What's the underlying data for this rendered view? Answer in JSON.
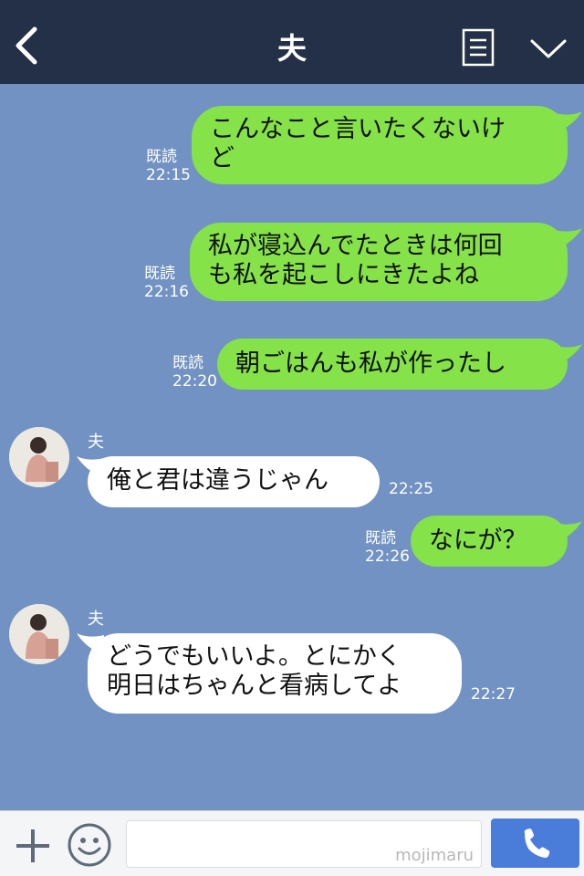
{
  "header": {
    "title": "夫",
    "back_icon": "chevron-left-icon",
    "menu_icon": "list-icon",
    "expand_icon": "chevron-down-icon"
  },
  "messages": [
    {
      "from": "me",
      "lines": [
        "こんなこと言いたくないけ",
        "ど"
      ],
      "read": "既読",
      "time": "22:15"
    },
    {
      "from": "me",
      "lines": [
        "私が寝込んでたときは何回",
        "も私を起こしにきたよね"
      ],
      "read": "既読",
      "time": "22:16"
    },
    {
      "from": "me",
      "lines": [
        "朝ごはんも私が作ったし"
      ],
      "read": "既読",
      "time": "22:20"
    },
    {
      "from": "them",
      "sender": "夫",
      "lines": [
        "俺と君は違うじゃん"
      ],
      "time": "22:25"
    },
    {
      "from": "me",
      "lines": [
        "なにが？"
      ],
      "read": "既読",
      "time": "22:26"
    },
    {
      "from": "them",
      "sender": "夫",
      "lines": [
        "どうでもいいよ。とにかく",
        "明日はちゃんと看病してよ"
      ],
      "time": "22:27"
    }
  ],
  "input": {
    "placeholder": "",
    "watermark": "mojimaru",
    "plus_icon": "plus-icon",
    "emoji_icon": "emoji-icon",
    "call_icon": "phone-icon"
  },
  "colors": {
    "header": "#233047",
    "background": "#7192c2",
    "my_bubble": "#85e249",
    "their_bubble": "#ffffff",
    "call_button": "#4a7dd9"
  }
}
